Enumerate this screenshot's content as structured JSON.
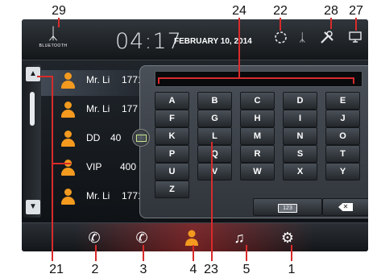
{
  "status_bar": {
    "bluetooth_label": "BLUETOOTH",
    "time": "04:17",
    "date": "FEBRUARY 10, 2014"
  },
  "contacts": [
    {
      "name": "Mr. Li",
      "number": "1771"
    },
    {
      "name": "Mr. Li",
      "number": "177"
    },
    {
      "name": "DD",
      "number": "40"
    },
    {
      "name": "VIP",
      "number": "400"
    },
    {
      "name": "Mr. Li",
      "number": "1771"
    }
  ],
  "keyboard": {
    "input_value": "",
    "rows": [
      [
        "A",
        "B",
        "C",
        "D",
        "E"
      ],
      [
        "F",
        "G",
        "H",
        "I",
        "J"
      ],
      [
        "K",
        "L",
        "M",
        "N",
        "O"
      ],
      [
        "P",
        "Q",
        "R",
        "S",
        "T"
      ],
      [
        "U",
        "V",
        "W",
        "X",
        "Y"
      ],
      [
        "Z"
      ]
    ],
    "number_mode_label": "123"
  },
  "callouts": {
    "c29": "29",
    "c24": "24",
    "c22": "22",
    "c28": "28",
    "c27": "27",
    "c21": "21",
    "c2": "2",
    "c3": "3",
    "c4": "4",
    "c23": "23",
    "c5": "5",
    "c1": "1"
  },
  "colors": {
    "accent": "#f39a1f",
    "callout_line": "#d92b2b",
    "dock_glow": "#be2828"
  },
  "icons": {
    "status": [
      "bluetooth-icon",
      "loading-icon",
      "bluetooth-icon",
      "settings-tools-icon",
      "screen-icon"
    ],
    "dock": [
      "phone-icon",
      "call-log-icon",
      "contacts-icon",
      "music-icon",
      "settings-icon"
    ]
  }
}
